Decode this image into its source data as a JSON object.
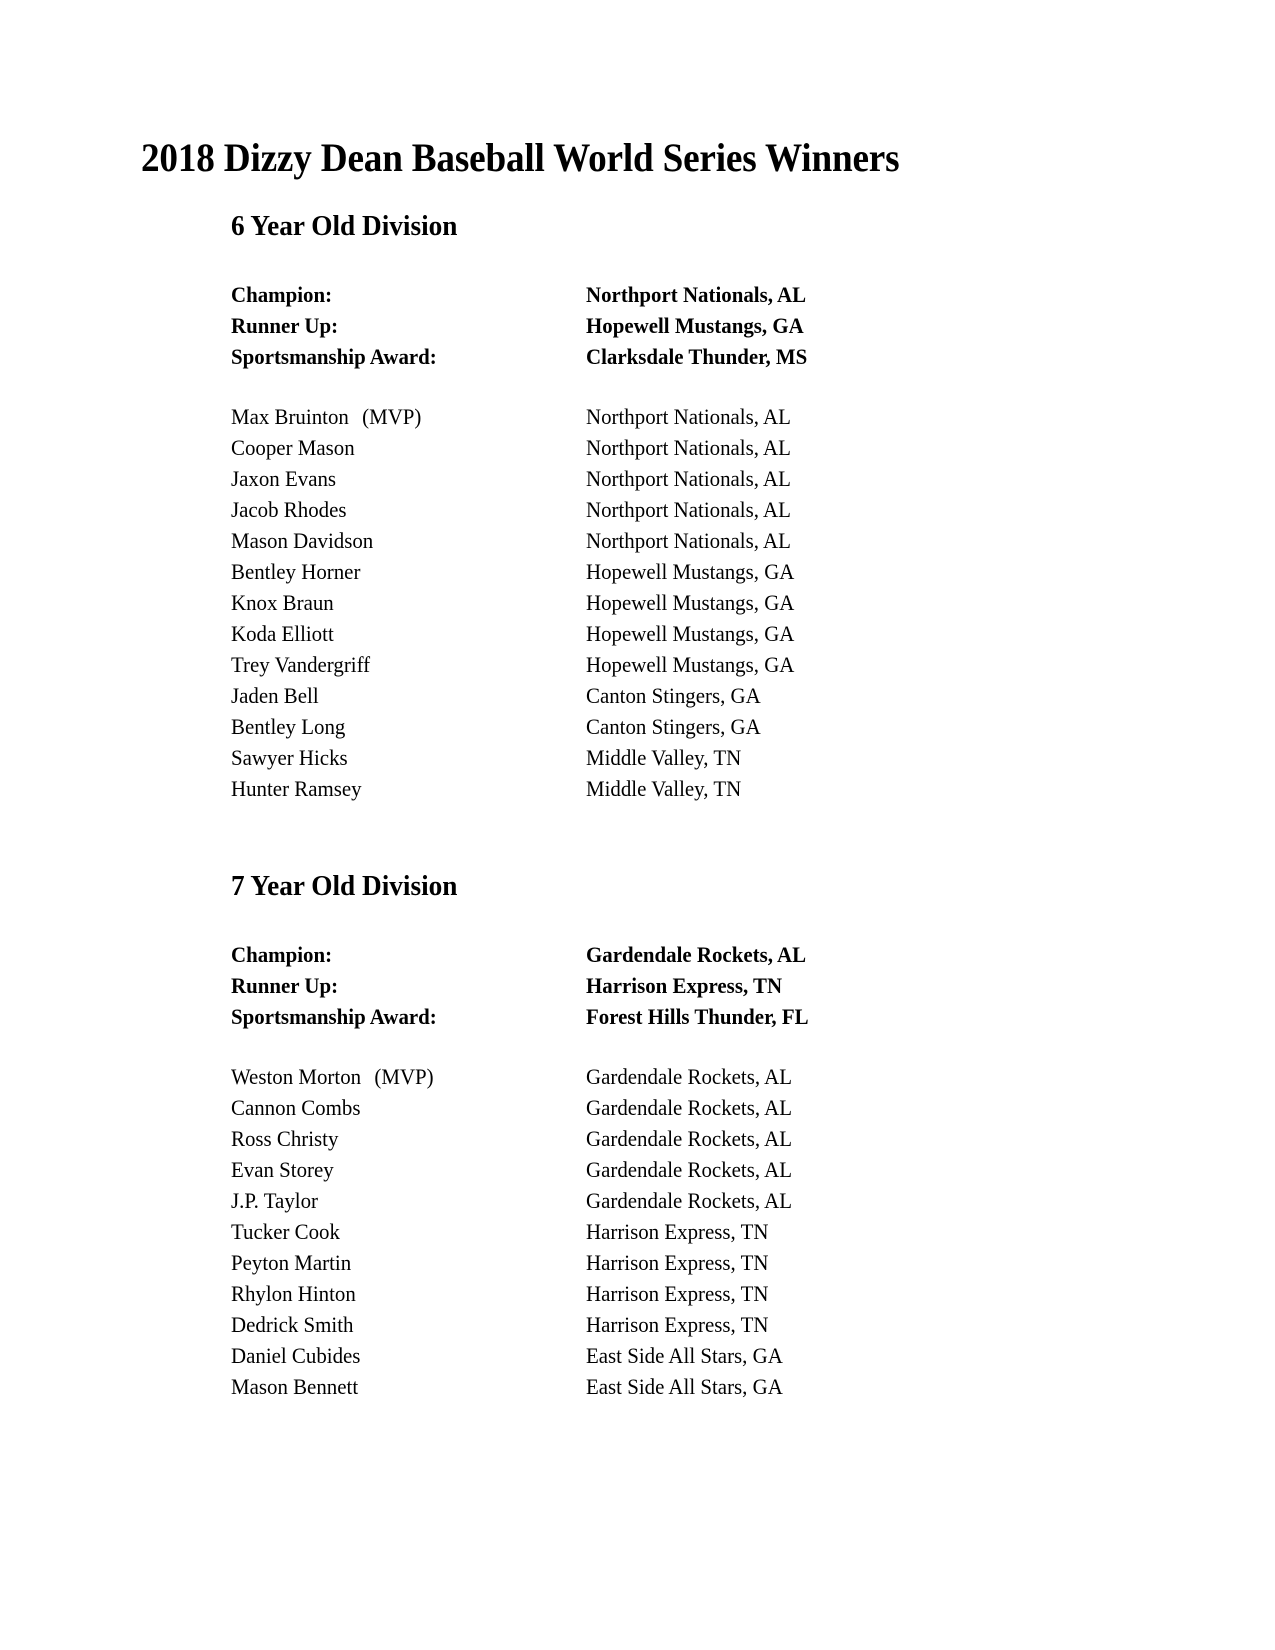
{
  "document": {
    "title": "2018 Dizzy Dean Baseball World Series Winners"
  },
  "sections": [
    {
      "heading": "6 Year Old Division",
      "awards": [
        {
          "label": "Champion:",
          "value": "Northport Nationals, AL"
        },
        {
          "label": "Runner Up:",
          "value": "Hopewell Mustangs, GA"
        },
        {
          "label": "Sportsmanship Award:",
          "value": "Clarksdale Thunder, MS"
        }
      ],
      "players": [
        {
          "name": "Max Bruinton",
          "tag": "(MVP)",
          "team": "Northport Nationals, AL"
        },
        {
          "name": "Cooper Mason",
          "tag": "",
          "team": "Northport Nationals, AL"
        },
        {
          "name": "Jaxon Evans",
          "tag": "",
          "team": "Northport Nationals, AL"
        },
        {
          "name": "Jacob Rhodes",
          "tag": "",
          "team": "Northport Nationals, AL"
        },
        {
          "name": "Mason Davidson",
          "tag": "",
          "team": "Northport Nationals, AL"
        },
        {
          "name": "Bentley Horner",
          "tag": "",
          "team": "Hopewell Mustangs, GA"
        },
        {
          "name": "Knox Braun",
          "tag": "",
          "team": "Hopewell Mustangs, GA"
        },
        {
          "name": "Koda Elliott",
          "tag": "",
          "team": "Hopewell Mustangs, GA"
        },
        {
          "name": "Trey Vandergriff",
          "tag": "",
          "team": "Hopewell Mustangs, GA"
        },
        {
          "name": "Jaden Bell",
          "tag": "",
          "team": "Canton Stingers, GA"
        },
        {
          "name": "Bentley Long",
          "tag": "",
          "team": "Canton Stingers, GA"
        },
        {
          "name": "Sawyer Hicks",
          "tag": "",
          "team": "Middle Valley, TN"
        },
        {
          "name": "Hunter Ramsey",
          "tag": "",
          "team": "Middle Valley, TN"
        }
      ]
    },
    {
      "heading": "7 Year Old Division",
      "awards": [
        {
          "label": "Champion:",
          "value": "Gardendale Rockets, AL"
        },
        {
          "label": "Runner Up:",
          "value": "Harrison Express, TN"
        },
        {
          "label": "Sportsmanship Award:",
          "value": "Forest Hills Thunder, FL"
        }
      ],
      "players": [
        {
          "name": "Weston Morton",
          "tag": "(MVP)",
          "team": "Gardendale Rockets, AL"
        },
        {
          "name": "Cannon Combs",
          "tag": "",
          "team": "Gardendale Rockets, AL"
        },
        {
          "name": "Ross Christy",
          "tag": "",
          "team": "Gardendale Rockets, AL"
        },
        {
          "name": "Evan Storey",
          "tag": "",
          "team": "Gardendale Rockets, AL"
        },
        {
          "name": "J.P. Taylor",
          "tag": "",
          "team": "Gardendale Rockets, AL"
        },
        {
          "name": "Tucker Cook",
          "tag": "",
          "team": "Harrison Express, TN"
        },
        {
          "name": "Peyton Martin",
          "tag": "",
          "team": "Harrison Express, TN"
        },
        {
          "name": "Rhylon Hinton",
          "tag": "",
          "team": "Harrison Express, TN"
        },
        {
          "name": "Dedrick Smith",
          "tag": "",
          "team": "Harrison Express, TN"
        },
        {
          "name": "Daniel Cubides",
          "tag": "",
          "team": "East Side All Stars, GA"
        },
        {
          "name": "Mason Bennett",
          "tag": "",
          "team": "East Side All Stars, GA"
        }
      ]
    }
  ]
}
